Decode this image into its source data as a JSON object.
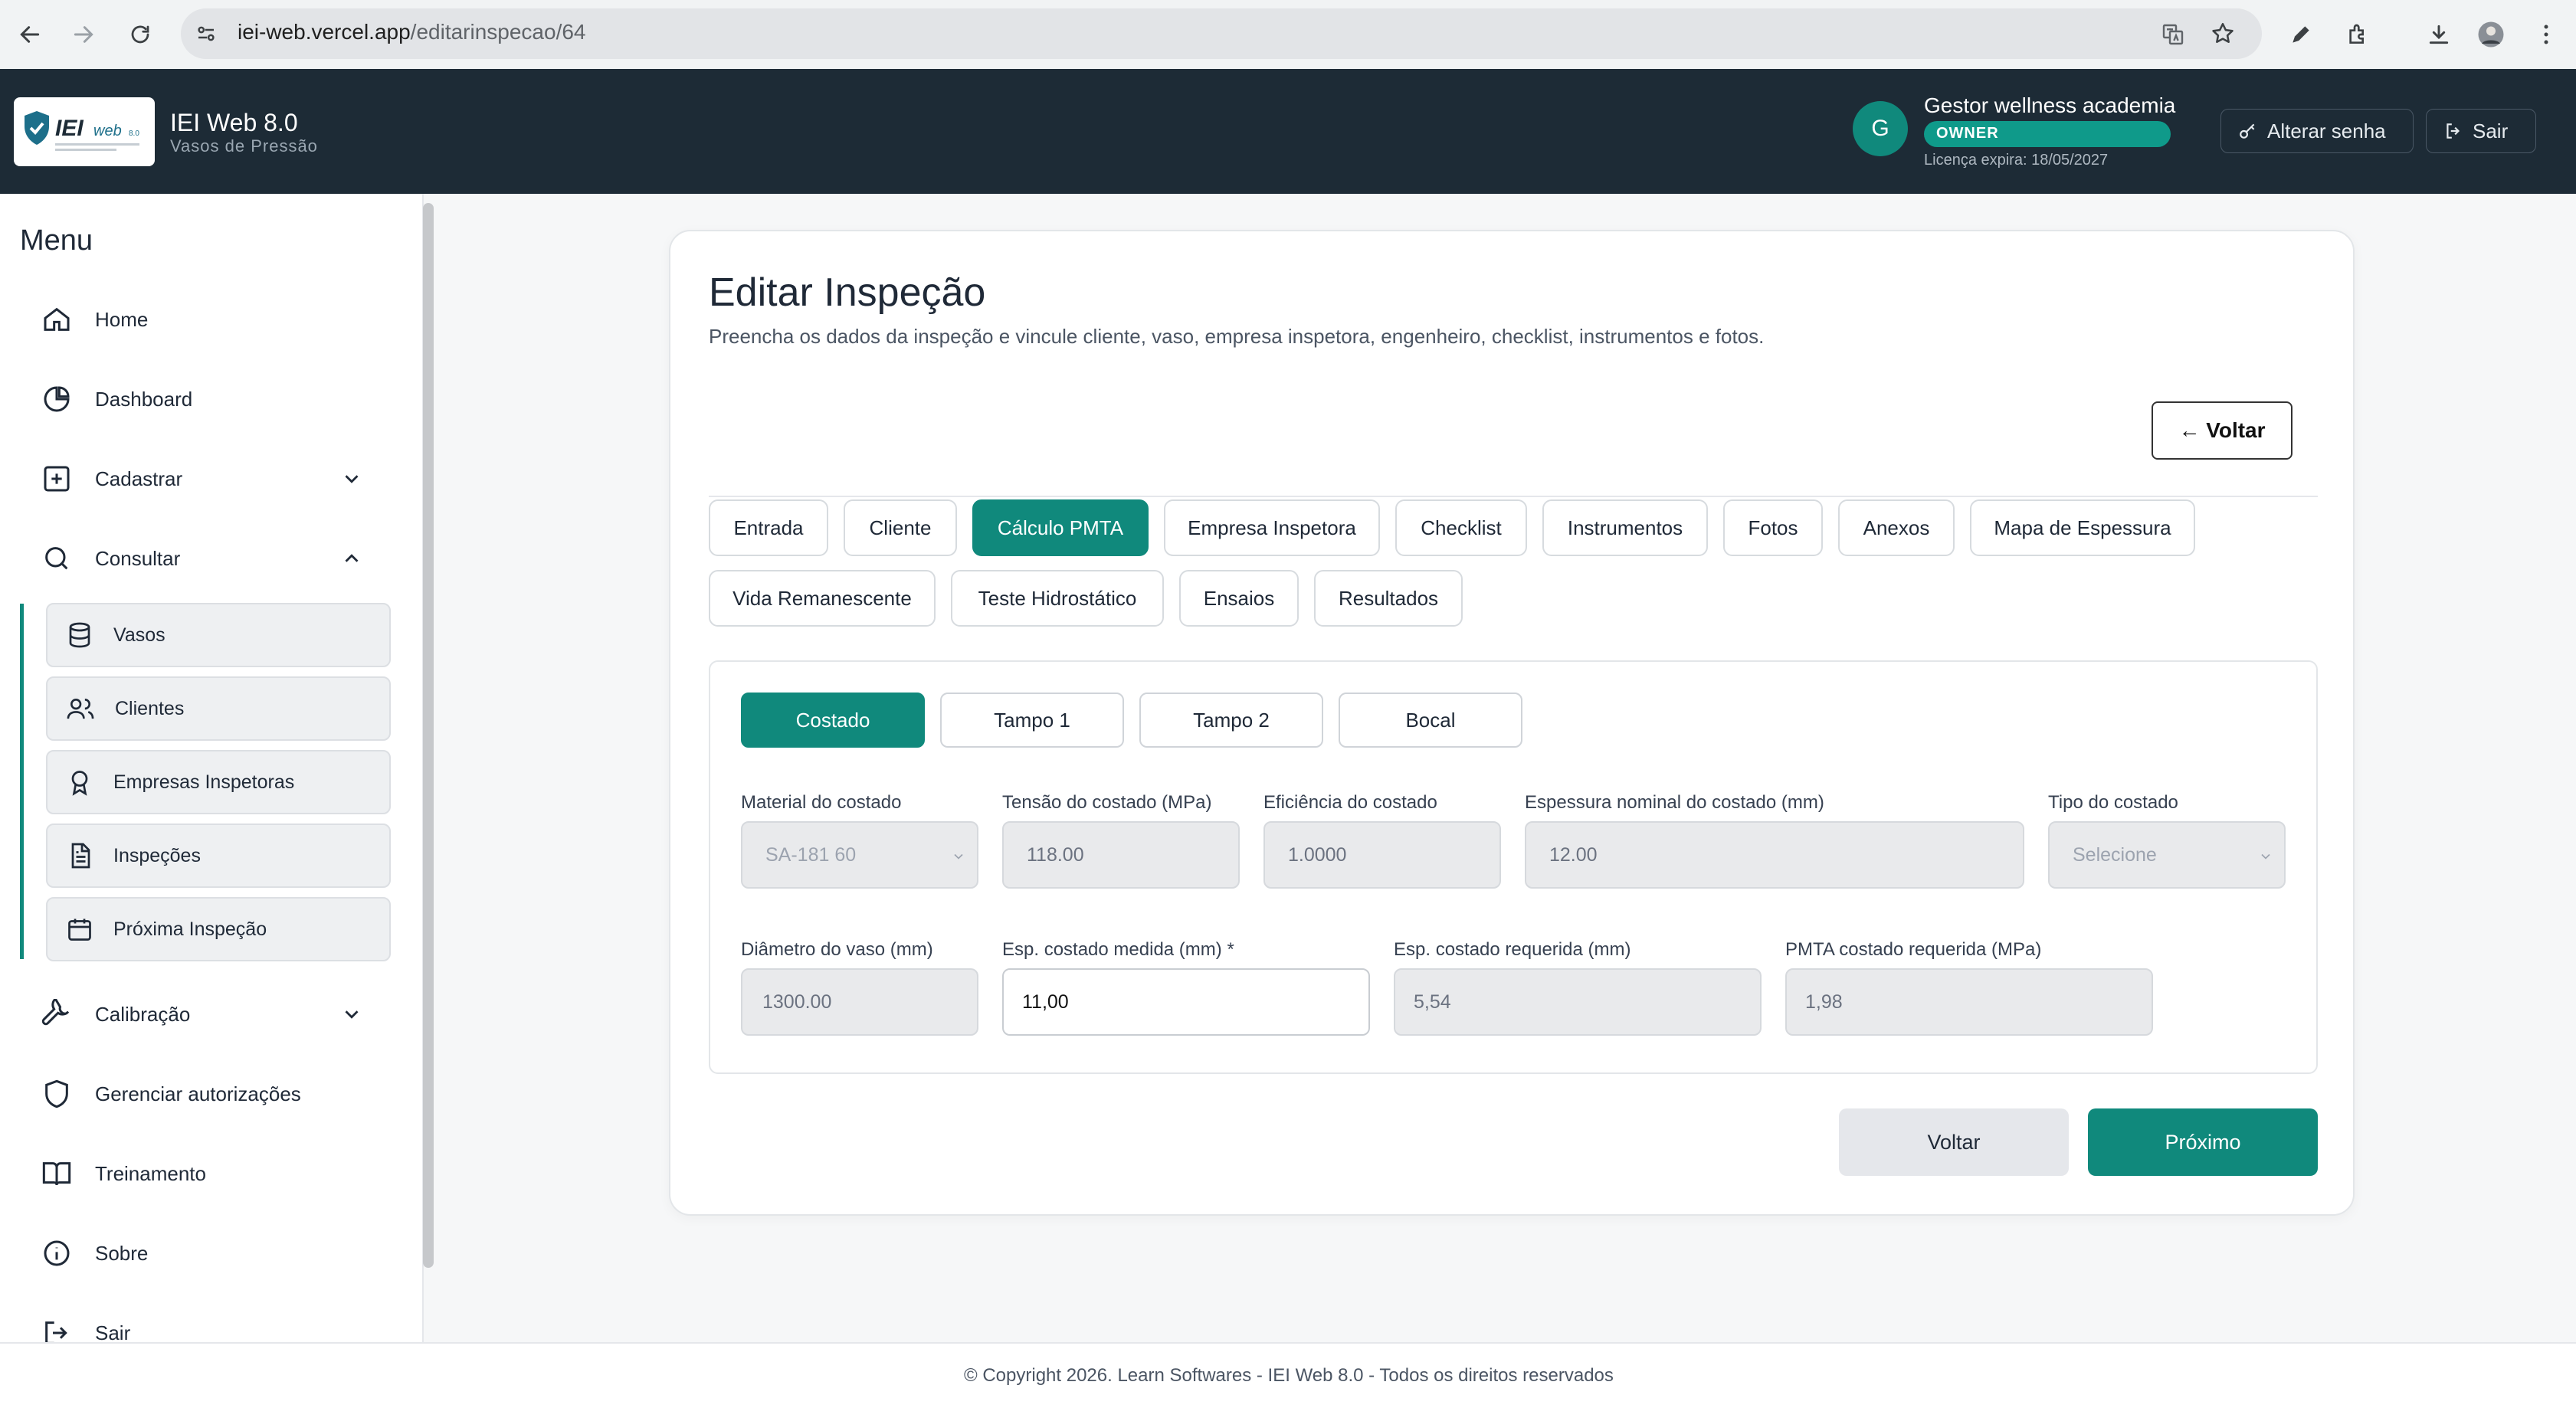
{
  "browser": {
    "url_host": "iei-web.vercel.app",
    "url_path": "/editarinspecao/64"
  },
  "header": {
    "app_title": "IEI Web 8.0",
    "app_subtitle": "Vasos de Pressão",
    "logo_text": "IEI web",
    "logo_version": "8.0",
    "avatar_initial": "G",
    "user_name": "Gestor wellness academia",
    "role": "OWNER",
    "license": "Licença expira: 18/05/2027",
    "change_password": "Alterar senha",
    "logout": "Sair"
  },
  "sidebar": {
    "title": "Menu",
    "items": [
      {
        "label": "Home",
        "icon": "home-icon"
      },
      {
        "label": "Dashboard",
        "icon": "pie-chart-icon"
      },
      {
        "label": "Cadastrar",
        "icon": "plus-square-icon"
      },
      {
        "label": "Consultar",
        "icon": "search-icon"
      },
      {
        "label": "Calibração",
        "icon": "wrench-icon"
      },
      {
        "label": "Gerenciar autorizações",
        "icon": "shield-icon"
      },
      {
        "label": "Treinamento",
        "icon": "book-icon"
      },
      {
        "label": "Sobre",
        "icon": "info-icon"
      },
      {
        "label": "Sair",
        "icon": "logout-icon"
      }
    ],
    "consultar_sub": [
      {
        "label": "Vasos",
        "icon": "database-icon"
      },
      {
        "label": "Clientes",
        "icon": "users-icon"
      },
      {
        "label": "Empresas Inspetoras",
        "icon": "award-icon"
      },
      {
        "label": "Inspeções",
        "icon": "file-text-icon"
      },
      {
        "label": "Próxima Inspeção",
        "icon": "calendar-icon"
      }
    ]
  },
  "page": {
    "title": "Editar Inspeção",
    "description": "Preencha os dados da inspeção e vincule cliente, vaso, empresa inspetora, engenheiro, checklist, instrumentos e fotos.",
    "back_top": "← Voltar",
    "tabs": [
      "Entrada",
      "Cliente",
      "Cálculo PMTA",
      "Empresa Inspetora",
      "Checklist",
      "Instrumentos",
      "Fotos",
      "Anexos",
      "Mapa de Espessura",
      "Vida Remanescente",
      "Teste Hidrostático",
      "Ensaios",
      "Resultados"
    ],
    "active_tab": "Cálculo PMTA",
    "subtabs": [
      "Costado",
      "Tampo 1",
      "Tampo 2",
      "Bocal"
    ],
    "active_subtab": "Costado",
    "fields": {
      "material": {
        "label": "Material do costado",
        "value": "SA-181 60"
      },
      "tensao": {
        "label": "Tensão do costado (MPa)",
        "value": "118.00"
      },
      "eficiencia": {
        "label": "Eficiência do costado",
        "value": "1.0000"
      },
      "espessura_nominal": {
        "label": "Espessura nominal do costado (mm)",
        "value": "12.00"
      },
      "tipo": {
        "label": "Tipo do costado",
        "value": "Selecione"
      },
      "diametro": {
        "label": "Diâmetro do vaso (mm)",
        "value": "1300.00"
      },
      "esp_medida": {
        "label": "Esp. costado medida (mm) *",
        "value": "11,00"
      },
      "esp_requerida": {
        "label": "Esp. costado requerida (mm)",
        "value": "5,54"
      },
      "pmta_requerida": {
        "label": "PMTA costado requerida (MPa)",
        "value": "1,98"
      }
    },
    "btn_back": "Voltar",
    "btn_next": "Próximo"
  },
  "footer": {
    "text": "© Copyright 2026. Learn Softwares - IEI Web 8.0 - Todos os direitos reservados"
  },
  "colors": {
    "accent": "#10897c",
    "header_bg": "#1d2b36"
  }
}
